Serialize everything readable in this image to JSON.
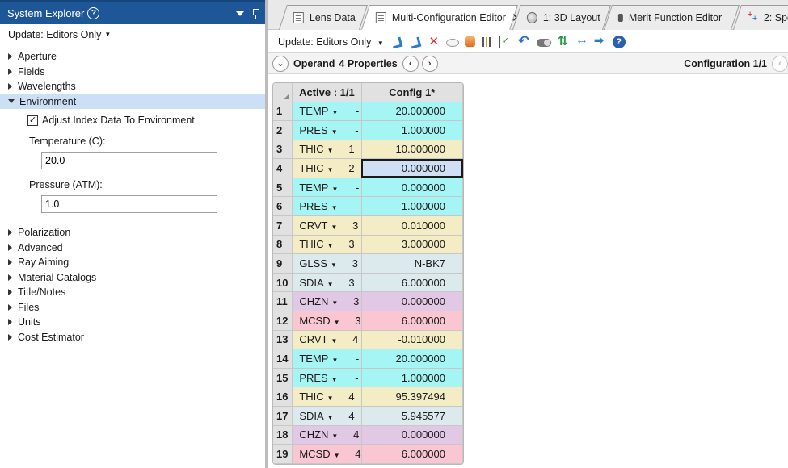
{
  "left_panel": {
    "title": "System Explorer",
    "help_glyph": "?",
    "update_label": "Update: Editors Only",
    "tree_items_before": [
      "Aperture",
      "Fields",
      "Wavelengths"
    ],
    "selected_item": "Environment",
    "environment": {
      "checkbox_label": "Adjust Index Data To Environment",
      "checkbox_checked": true,
      "temperature_label": "Temperature (C):",
      "temperature_value": "20.0",
      "pressure_label": "Pressure (ATM):",
      "pressure_value": "1.0"
    },
    "tree_items_after": [
      "Polarization",
      "Advanced",
      "Ray Aiming",
      "Material Catalogs",
      "Title/Notes",
      "Files",
      "Units",
      "Cost Estimator"
    ]
  },
  "tabs": [
    {
      "label": "Lens Data",
      "icon": "doc-icon",
      "active": false
    },
    {
      "label": "Multi-Configuration Editor",
      "icon": "doc-icon",
      "active": true
    },
    {
      "label": "1: 3D Layout",
      "icon": "lens3d-icon",
      "active": false
    },
    {
      "label": "Merit Function Editor",
      "icon": "merit-icon",
      "active": false
    },
    {
      "label": "2: Spo",
      "icon": "spot-icon",
      "active": false
    }
  ],
  "toolbar": {
    "update_label": "Update: Editors Only"
  },
  "operand_bar": {
    "operand_label": "Operand",
    "properties_label": "4 Properties",
    "configuration_label": "Configuration 1/1"
  },
  "grid": {
    "header_active": "Active : 1/1",
    "header_config": "Config 1*",
    "selected_row": 4,
    "colors": {
      "TEMP": "#a6f5f5",
      "PRES": "#a6f5f5",
      "THIC": "#f3ecc4",
      "CRVT": "#f3ecc4",
      "GLSS": "#dce9ed",
      "SDIA": "#dce9ed",
      "CHZN": "#e1c8e5",
      "MCSD": "#f9c6d2"
    },
    "rows": [
      {
        "n": "1",
        "op": "TEMP",
        "surf": "-",
        "value": "20.000000"
      },
      {
        "n": "2",
        "op": "PRES",
        "surf": "-",
        "value": "1.000000"
      },
      {
        "n": "3",
        "op": "THIC",
        "surf": "1",
        "value": "10.000000"
      },
      {
        "n": "4",
        "op": "THIC",
        "surf": "2",
        "value": "0.000000"
      },
      {
        "n": "5",
        "op": "TEMP",
        "surf": "-",
        "value": "0.000000"
      },
      {
        "n": "6",
        "op": "PRES",
        "surf": "-",
        "value": "1.000000"
      },
      {
        "n": "7",
        "op": "CRVT",
        "surf": "3",
        "value": "0.010000"
      },
      {
        "n": "8",
        "op": "THIC",
        "surf": "3",
        "value": "3.000000"
      },
      {
        "n": "9",
        "op": "GLSS",
        "surf": "3",
        "value": "N-BK7"
      },
      {
        "n": "10",
        "op": "SDIA",
        "surf": "3",
        "value": "6.000000"
      },
      {
        "n": "11",
        "op": "CHZN",
        "surf": "3",
        "value": "0.000000"
      },
      {
        "n": "12",
        "op": "MCSD",
        "surf": "3",
        "value": "6.000000"
      },
      {
        "n": "13",
        "op": "CRVT",
        "surf": "4",
        "value": "-0.010000"
      },
      {
        "n": "14",
        "op": "TEMP",
        "surf": "-",
        "value": "20.000000"
      },
      {
        "n": "15",
        "op": "PRES",
        "surf": "-",
        "value": "1.000000"
      },
      {
        "n": "16",
        "op": "THIC",
        "surf": "4",
        "value": "95.397494"
      },
      {
        "n": "17",
        "op": "SDIA",
        "surf": "4",
        "value": "5.945577"
      },
      {
        "n": "18",
        "op": "CHZN",
        "surf": "4",
        "value": "0.000000"
      },
      {
        "n": "19",
        "op": "MCSD",
        "surf": "4",
        "value": "6.000000"
      }
    ]
  }
}
